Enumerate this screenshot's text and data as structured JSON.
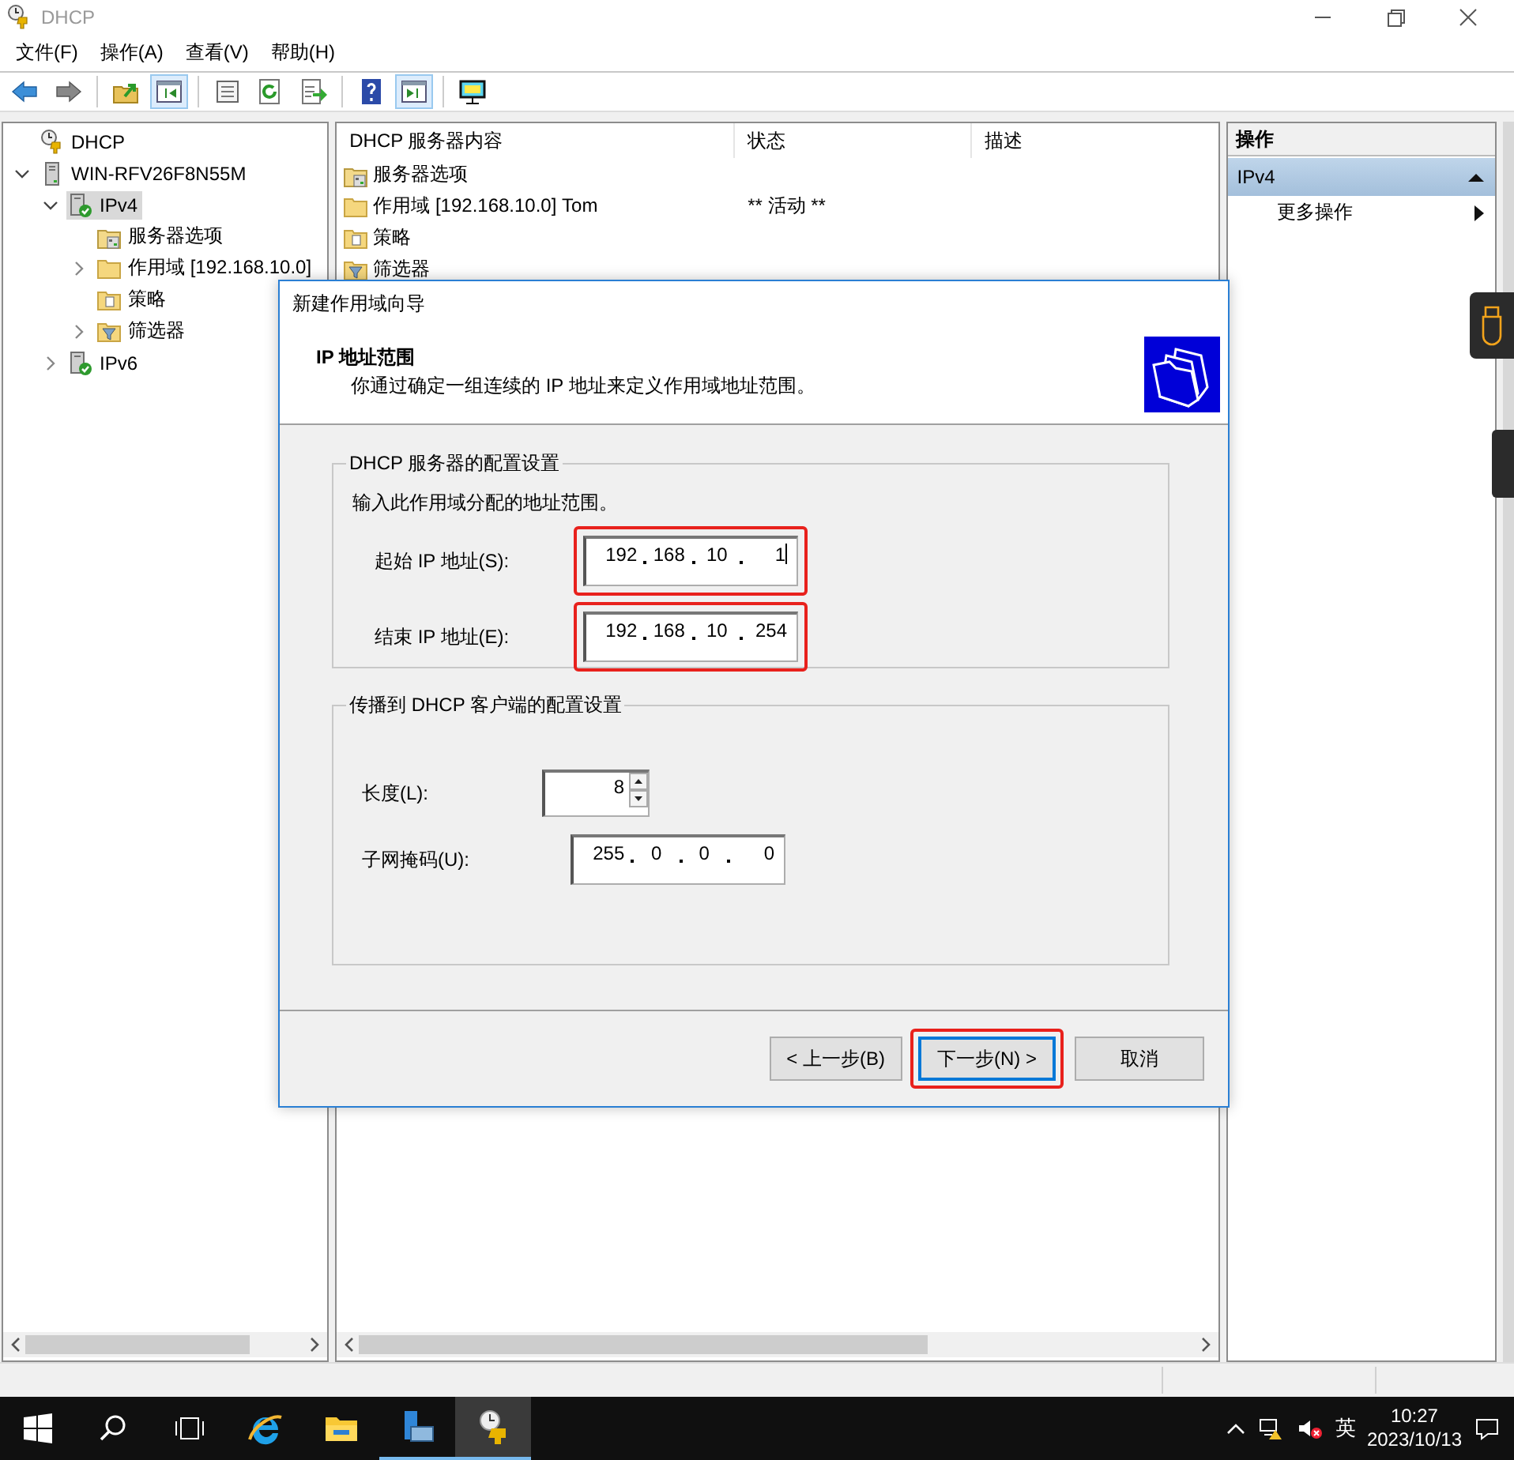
{
  "window": {
    "title": "DHCP"
  },
  "menu": [
    "文件(F)",
    "操作(A)",
    "查看(V)",
    "帮助(H)"
  ],
  "toolbar": [
    {
      "kind": "back",
      "pressed": false
    },
    {
      "kind": "forward",
      "pressed": false
    },
    {
      "kind": "separator"
    },
    {
      "kind": "up",
      "pressed": false
    },
    {
      "kind": "tree-toggle",
      "pressed": true
    },
    {
      "kind": "separator"
    },
    {
      "kind": "sheet",
      "pressed": false
    },
    {
      "kind": "refresh",
      "pressed": false
    },
    {
      "kind": "export",
      "pressed": false
    },
    {
      "kind": "separator"
    },
    {
      "kind": "help",
      "pressed": false
    },
    {
      "kind": "action-toggle",
      "pressed": true
    },
    {
      "kind": "separator"
    },
    {
      "kind": "monitor",
      "pressed": false
    }
  ],
  "tree": [
    {
      "label": "DHCP",
      "kind": "dhcp",
      "selected": false,
      "children": [
        {
          "label": "WIN-RFV26F8N55M",
          "kind": "server",
          "expanded": true,
          "selected": false,
          "children": [
            {
              "label": "IPv4",
              "kind": "ipv4",
              "expanded": true,
              "selected": true,
              "children": [
                {
                  "label": "服务器选项",
                  "kind": "options",
                  "selected": false
                },
                {
                  "label": "作用域 [192.168.10.0]",
                  "kind": "folder",
                  "expanded": false,
                  "selected": false
                },
                {
                  "label": "策略",
                  "kind": "policy",
                  "selected": false
                },
                {
                  "label": "筛选器",
                  "kind": "filter",
                  "expanded": false,
                  "selected": false
                }
              ]
            },
            {
              "label": "IPv6",
              "kind": "ipv4",
              "expanded": false,
              "selected": false
            }
          ]
        }
      ]
    }
  ],
  "list": {
    "columns": [
      "DHCP 服务器内容",
      "状态",
      "描述"
    ],
    "rows": [
      {
        "kind": "options",
        "name": "服务器选项"
      },
      {
        "kind": "folder",
        "name": "作用域 [192.168.10.0] Tom",
        "status": "** 活动 **"
      },
      {
        "kind": "policy",
        "name": "策略"
      },
      {
        "kind": "filter",
        "name": "筛选器"
      }
    ]
  },
  "actions": {
    "header": "操作",
    "section": "IPv4",
    "items": [
      "更多操作"
    ]
  },
  "dialog": {
    "title": "新建作用域向导",
    "heading": "IP 地址范围",
    "subheading": "你通过确定一组连续的 IP 地址来定义作用域地址范围。",
    "groups": [
      {
        "legend": "DHCP 服务器的配置设置",
        "intro": "输入此作用域分配的地址范围。",
        "fields": [
          {
            "kind": "ip",
            "label": "起始 IP 地址(S):",
            "octets": [
              "192",
              "168",
              "10",
              "1"
            ],
            "focused": true,
            "highlighted": true
          },
          {
            "kind": "ip",
            "label": "结束 IP 地址(E):",
            "octets": [
              "192",
              "168",
              "10",
              "254"
            ],
            "focused": false,
            "highlighted": true
          }
        ]
      },
      {
        "legend": "传播到 DHCP 客户端的配置设置",
        "fields": [
          {
            "kind": "spin",
            "label": "长度(L):",
            "value": "8"
          },
          {
            "kind": "ip",
            "label": "子网掩码(U):",
            "octets": [
              "255",
              "0",
              "0",
              "0"
            ],
            "focused": false,
            "highlighted": false
          }
        ]
      }
    ],
    "buttons": [
      {
        "label": "< 上一步(B)",
        "default": false,
        "highlighted": false
      },
      {
        "label": "下一步(N) >",
        "default": true,
        "highlighted": true
      },
      {
        "label": "取消",
        "default": false,
        "highlighted": false
      }
    ]
  },
  "taskbar": {
    "apps": [
      {
        "kind": "start",
        "running": false,
        "active": false
      },
      {
        "kind": "search",
        "running": false,
        "active": false
      },
      {
        "kind": "task-view",
        "running": false,
        "active": false
      },
      {
        "kind": "ie",
        "running": false,
        "active": false
      },
      {
        "kind": "explorer",
        "running": false,
        "active": false
      },
      {
        "kind": "server-manager",
        "running": true,
        "active": false
      },
      {
        "kind": "dhcp",
        "running": true,
        "active": true
      }
    ],
    "ime": "英",
    "time": "10:27",
    "date": "2023/10/13"
  }
}
